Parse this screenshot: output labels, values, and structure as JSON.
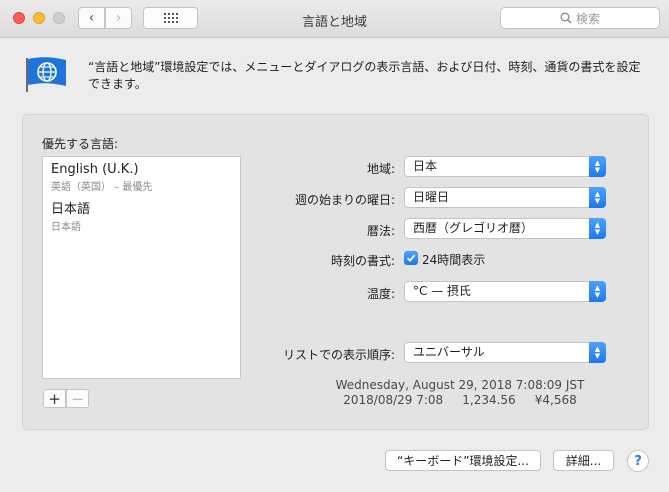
{
  "window": {
    "title": "言語と地域"
  },
  "toolbar": {
    "back_glyph": "‹",
    "forward_glyph": "›",
    "search_placeholder": "検索"
  },
  "header": {
    "description": "“言語と地域”環境設定では、メニューとダイアログの表示言語、および日付、時刻、通貨の書式を設定できます。"
  },
  "languages": {
    "label": "優先する言語:",
    "items": [
      {
        "name": "English (U.K.)",
        "sub": "英語（英国） – 最優先"
      },
      {
        "name": "日本語",
        "sub": "日本語"
      }
    ],
    "add_glyph": "+",
    "remove_glyph": "−"
  },
  "settings": {
    "region": {
      "label": "地域:",
      "value": "日本"
    },
    "first_day": {
      "label": "週の始まりの曜日:",
      "value": "日曜日"
    },
    "calendar": {
      "label": "暦法:",
      "value": "西暦（グレゴリオ暦）"
    },
    "time_format": {
      "label": "時刻の書式:",
      "checkbox_label": "24時間表示",
      "checked": true
    },
    "temperature": {
      "label": "温度:",
      "value": "°C — 摂氏"
    },
    "list_sort": {
      "label": "リストでの表示順序:",
      "value": "ユニバーサル"
    }
  },
  "sample": {
    "line1": "Wednesday, August 29, 2018 7:08:09 JST",
    "line2": "2018/08/29 7:08     1,234.56     ¥4,568"
  },
  "footer": {
    "keyboard_button": "“キーボード”環境設定...",
    "details_button": "詳細...",
    "help_glyph": "?"
  },
  "colors": {
    "accent": "#1f77f0",
    "close": "#fd5f57",
    "minimize": "#febc2e"
  },
  "icons": {
    "app": "flag-globe-icon",
    "search": "search-icon",
    "grid": "grid-icon",
    "popup_arrows": "chevron-updown-icon",
    "check": "checkmark-icon"
  }
}
